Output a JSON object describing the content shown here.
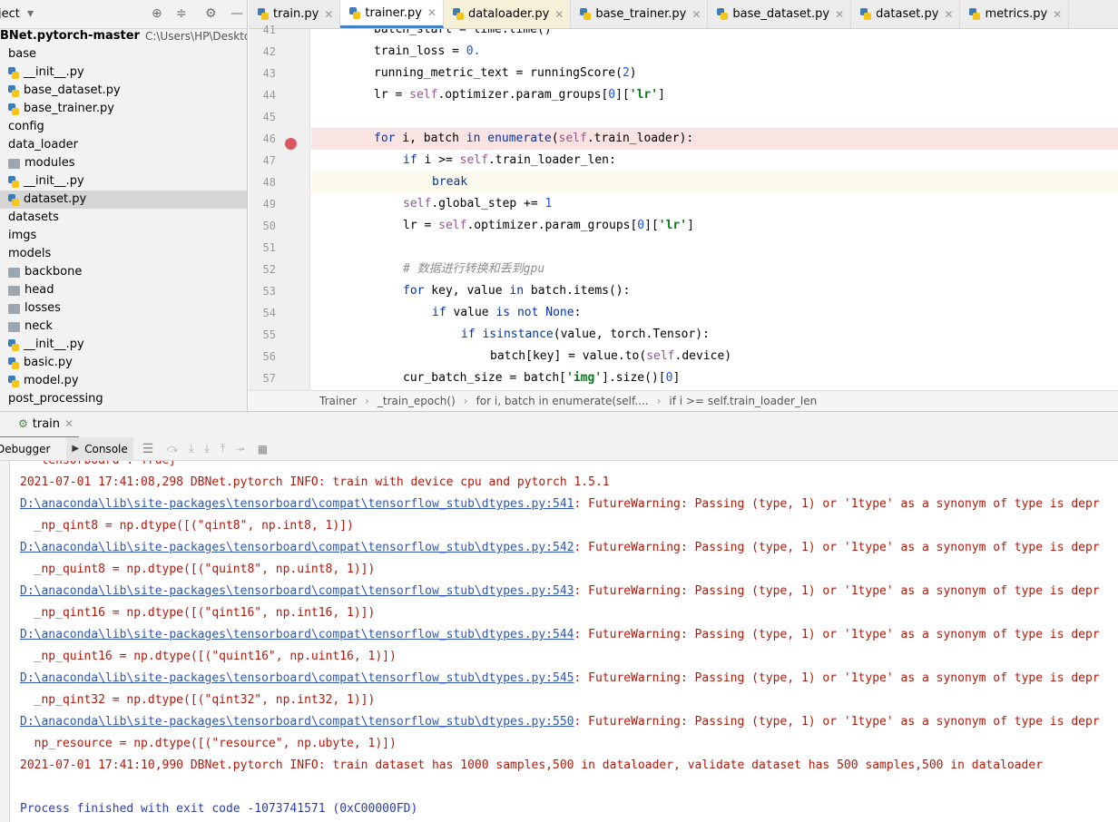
{
  "project": {
    "title": "ject",
    "root_name": "BNet.pytorch-master",
    "root_path": "C:\\Users\\HP\\Desktop\\D",
    "items": [
      {
        "label": "base",
        "type": "folder",
        "indent": 0
      },
      {
        "label": "__init__.py",
        "type": "py",
        "indent": 1
      },
      {
        "label": "base_dataset.py",
        "type": "py",
        "indent": 1
      },
      {
        "label": "base_trainer.py",
        "type": "py",
        "indent": 1
      },
      {
        "label": "config",
        "type": "folder",
        "indent": 0
      },
      {
        "label": "data_loader",
        "type": "folder",
        "indent": 0
      },
      {
        "label": "modules",
        "type": "folder",
        "indent": 1
      },
      {
        "label": "__init__.py",
        "type": "py",
        "indent": 1
      },
      {
        "label": "dataset.py",
        "type": "py",
        "indent": 1,
        "selected": true
      },
      {
        "label": "datasets",
        "type": "folder",
        "indent": 0
      },
      {
        "label": "imgs",
        "type": "folder",
        "indent": 0
      },
      {
        "label": "models",
        "type": "folder",
        "indent": 0
      },
      {
        "label": "backbone",
        "type": "folder",
        "indent": 1
      },
      {
        "label": "head",
        "type": "folder",
        "indent": 1
      },
      {
        "label": "losses",
        "type": "folder",
        "indent": 1
      },
      {
        "label": "neck",
        "type": "folder",
        "indent": 1
      },
      {
        "label": "__init__.py",
        "type": "py",
        "indent": 1
      },
      {
        "label": "basic.py",
        "type": "py",
        "indent": 1
      },
      {
        "label": "model.py",
        "type": "py",
        "indent": 1
      },
      {
        "label": "post_processing",
        "type": "folder",
        "indent": 0
      }
    ]
  },
  "tabs": [
    {
      "label": "train.py"
    },
    {
      "label": "trainer.py",
      "active": true
    },
    {
      "label": "dataloader.py"
    },
    {
      "label": "base_trainer.py"
    },
    {
      "label": "base_dataset.py"
    },
    {
      "label": "dataset.py"
    },
    {
      "label": "metrics.py"
    }
  ],
  "code_lines": [
    {
      "n": "41",
      "indent": 2,
      "text": "batch_start = time.time()"
    },
    {
      "n": "42",
      "indent": 2,
      "text": "train_loss = 0."
    },
    {
      "n": "43",
      "indent": 2,
      "text": "running_metric_text = runningScore(2)"
    },
    {
      "n": "44",
      "indent": 2,
      "text": "lr = self.optimizer.param_groups[0]['lr']"
    },
    {
      "n": "45",
      "indent": 0,
      "text": ""
    },
    {
      "n": "46",
      "indent": 2,
      "text": "for i, batch in enumerate(self.train_loader):",
      "breakpoint": true
    },
    {
      "n": "47",
      "indent": 3,
      "text": "if i >= self.train_loader_len:"
    },
    {
      "n": "48",
      "indent": 4,
      "text": "break",
      "current": true
    },
    {
      "n": "49",
      "indent": 3,
      "text": "self.global_step += 1"
    },
    {
      "n": "50",
      "indent": 3,
      "text": "lr = self.optimizer.param_groups[0]['lr']"
    },
    {
      "n": "51",
      "indent": 0,
      "text": ""
    },
    {
      "n": "52",
      "indent": 3,
      "text": "# 数据进行转换和丢到gpu"
    },
    {
      "n": "53",
      "indent": 3,
      "text": "for key, value in batch.items():"
    },
    {
      "n": "54",
      "indent": 4,
      "text": "if value is not None:"
    },
    {
      "n": "55",
      "indent": 5,
      "text": "if isinstance(value, torch.Tensor):"
    },
    {
      "n": "56",
      "indent": 6,
      "text": "batch[key] = value.to(self.device)"
    },
    {
      "n": "57",
      "indent": 3,
      "text": "cur_batch_size = batch['img'].size()[0]"
    }
  ],
  "breadcrumb": [
    "Trainer",
    "_train_epoch()",
    "for i, batch in enumerate(self....",
    "if i >= self.train_loader_len"
  ],
  "run": {
    "tab_label": "train",
    "debugger_label": "Debugger",
    "console_label": "Console"
  },
  "console_lines": [
    {
      "text": "  'tensorboard': True}"
    },
    {
      "text": "2021-07-01 17:41:08,298 DBNet.pytorch INFO: train with device cpu and pytorch 1.5.1"
    },
    {
      "link": "D:\\anaconda\\lib\\site-packages\\tensorboard\\compat\\tensorflow_stub\\dtypes.py:541",
      "text": ": FutureWarning: Passing (type, 1) or '1type' as a synonym of type is depr"
    },
    {
      "text": "  _np_qint8 = np.dtype([(\"qint8\", np.int8, 1)])"
    },
    {
      "link": "D:\\anaconda\\lib\\site-packages\\tensorboard\\compat\\tensorflow_stub\\dtypes.py:542",
      "text": ": FutureWarning: Passing (type, 1) or '1type' as a synonym of type is depr"
    },
    {
      "text": "  _np_quint8 = np.dtype([(\"quint8\", np.uint8, 1)])"
    },
    {
      "link": "D:\\anaconda\\lib\\site-packages\\tensorboard\\compat\\tensorflow_stub\\dtypes.py:543",
      "text": ": FutureWarning: Passing (type, 1) or '1type' as a synonym of type is depr"
    },
    {
      "text": "  _np_qint16 = np.dtype([(\"qint16\", np.int16, 1)])"
    },
    {
      "link": "D:\\anaconda\\lib\\site-packages\\tensorboard\\compat\\tensorflow_stub\\dtypes.py:544",
      "text": ": FutureWarning: Passing (type, 1) or '1type' as a synonym of type is depr"
    },
    {
      "text": "  _np_quint16 = np.dtype([(\"quint16\", np.uint16, 1)])"
    },
    {
      "link": "D:\\anaconda\\lib\\site-packages\\tensorboard\\compat\\tensorflow_stub\\dtypes.py:545",
      "text": ": FutureWarning: Passing (type, 1) or '1type' as a synonym of type is depr"
    },
    {
      "text": "  _np_qint32 = np.dtype([(\"qint32\", np.int32, 1)])"
    },
    {
      "link": "D:\\anaconda\\lib\\site-packages\\tensorboard\\compat\\tensorflow_stub\\dtypes.py:550",
      "text": ": FutureWarning: Passing (type, 1) or '1type' as a synonym of type is depr"
    },
    {
      "text": "  np_resource = np.dtype([(\"resource\", np.ubyte, 1)])"
    },
    {
      "text": "2021-07-01 17:41:10,990 DBNet.pytorch INFO: train dataset has 1000 samples,500 in dataloader, validate dataset has 500 samples,500 in dataloader"
    },
    {
      "text": ""
    },
    {
      "text": "Process finished with exit code -1073741571 (0xC00000FD)",
      "finished": true
    }
  ]
}
